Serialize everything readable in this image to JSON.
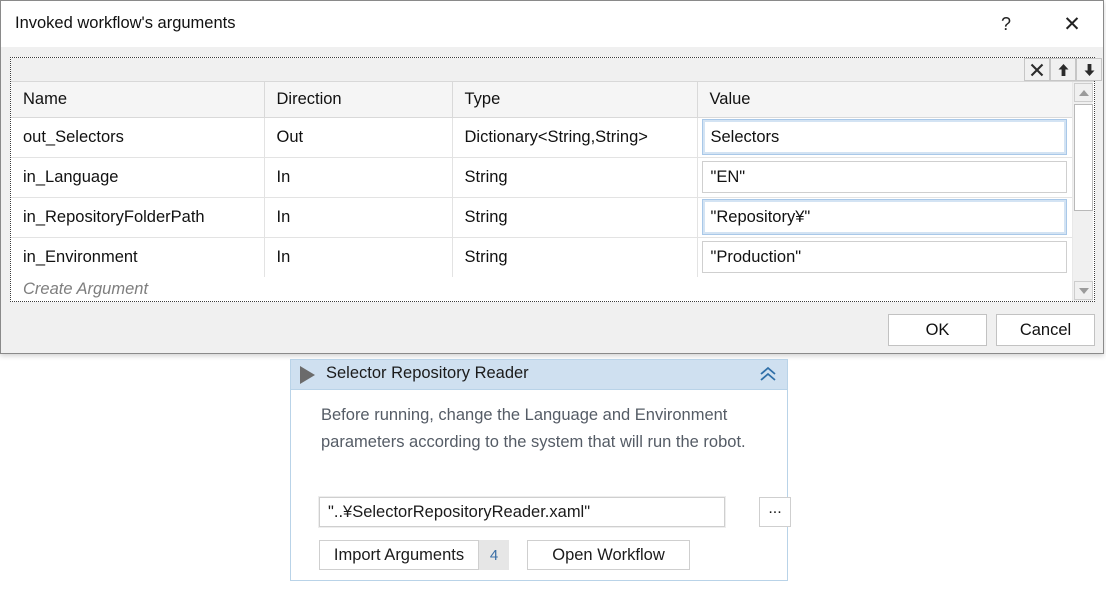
{
  "dialog": {
    "title": "Invoked workflow's arguments",
    "help_label": "?",
    "close_label": "✕",
    "ok_label": "OK",
    "cancel_label": "Cancel"
  },
  "toolbar": {
    "delete_label": "delete-icon",
    "move_up_label": "arrow-up-icon",
    "move_down_label": "arrow-down-icon"
  },
  "grid": {
    "columns": [
      "Name",
      "Direction",
      "Type",
      "Value"
    ],
    "rows": [
      {
        "name": "out_Selectors",
        "direction": "Out",
        "type": "Dictionary<String,String>",
        "value": "Selectors",
        "selected": true
      },
      {
        "name": "in_Language",
        "direction": "In",
        "type": "String",
        "value": "\"EN\"",
        "selected": false
      },
      {
        "name": "in_RepositoryFolderPath",
        "direction": "In",
        "type": "String",
        "value": "\"Repository¥\"",
        "selected": true
      },
      {
        "name": "in_Environment",
        "direction": "In",
        "type": "String",
        "value": "\"Production\"",
        "selected": false
      }
    ],
    "create_argument_label": "Create Argument"
  },
  "activity": {
    "title": "Selector Repository Reader",
    "collapse_label": "«",
    "description": "Before running, change the Language and Environment parameters according to the system that will run the robot.",
    "workflow_path": "\"..¥SelectorRepositoryReader.xaml\"",
    "browse_label": "...",
    "import_arguments_label": "Import Arguments",
    "import_arguments_count": "4",
    "open_workflow_label": "Open Workflow"
  },
  "colors": {
    "accent": "#cfe0f0",
    "card_border": "#b9d3e8",
    "badge_text": "#3a6ea5",
    "dialog_bg": "#f0f0f0"
  }
}
